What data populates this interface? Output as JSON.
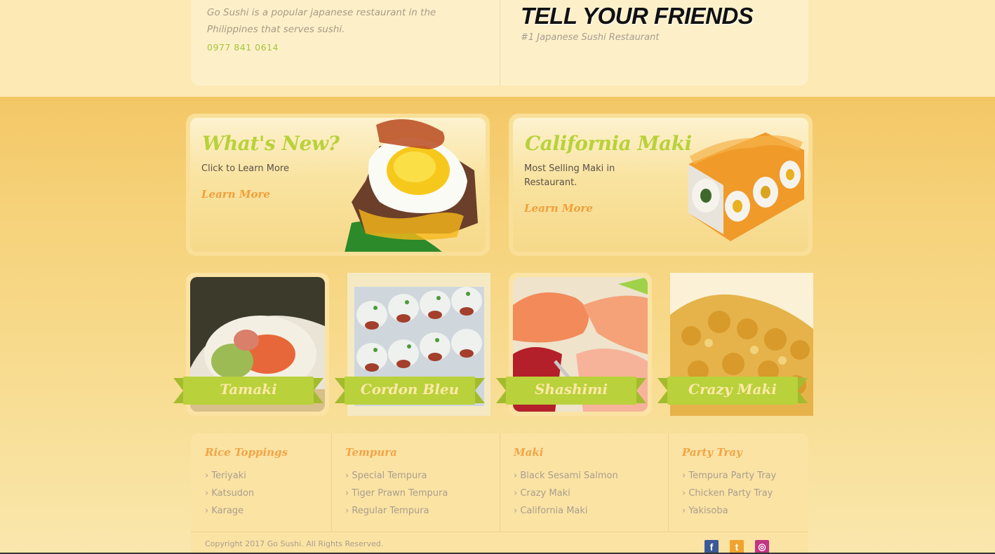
{
  "header": {
    "about": "Go Sushi is a popular japanese restaurant in the Philippines that serves sushi.",
    "phone": "0977 841 0614",
    "cta_title": "TELL YOUR FRIENDS",
    "tagline": "#1 Japanese Sushi Restaurant"
  },
  "promos": [
    {
      "title": "What's New?",
      "description": "Click to Learn More",
      "link": "Learn More",
      "image": "egg-topped-steak-image"
    },
    {
      "title": "California Maki",
      "description": "Most Selling Maki in Restaurant.",
      "link": "Learn More",
      "image": "california-maki-image"
    }
  ],
  "menu_tiles": [
    {
      "label": "Tamaki",
      "image": "tamaki-image"
    },
    {
      "label": "Cordon Bleu",
      "image": "cordon-bleu-image"
    },
    {
      "label": "Shashimi",
      "image": "sashimi-image"
    },
    {
      "label": "Crazy Maki",
      "image": "crazy-maki-image"
    }
  ],
  "footer": {
    "columns": [
      {
        "title": "Rice Toppings",
        "items": [
          "Teriyaki",
          "Katsudon",
          "Karage"
        ]
      },
      {
        "title": "Tempura",
        "items": [
          "Special Tempura",
          "Tiger Prawn Tempura",
          "Regular Tempura"
        ]
      },
      {
        "title": "Maki",
        "items": [
          "Black Sesami Salmon",
          "Crazy Maki",
          "California Maki"
        ]
      },
      {
        "title": "Party Tray",
        "items": [
          "Tempura Party Tray",
          "Chicken Party Tray",
          "Yakisoba"
        ]
      }
    ],
    "copyright": "Copyright 2017 Go Sushi. All Rights Reserved.",
    "social": [
      {
        "name": "facebook-icon",
        "glyph": "f",
        "color": "#3b5998"
      },
      {
        "name": "twitter-icon",
        "glyph": "t",
        "color": "#f0a430"
      },
      {
        "name": "instagram-icon",
        "glyph": "◎",
        "color": "#c13584"
      }
    ]
  },
  "colors": {
    "accent_green": "#b9d13a",
    "accent_orange": "#f0a03a",
    "background": "#f6d27a"
  }
}
